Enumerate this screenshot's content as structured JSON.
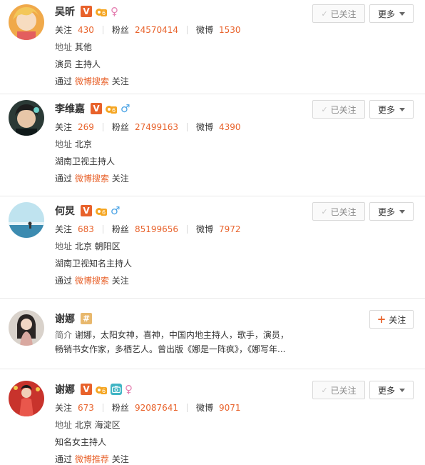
{
  "labels": {
    "followed": "已关注",
    "more": "更多",
    "follow": "关注",
    "following": "关注",
    "fans": "粉丝",
    "weibo": "微博",
    "address": "地址",
    "via": "通过",
    "follow_suffix": "关注",
    "intro": "简介"
  },
  "users": [
    {
      "name": "吴昕",
      "following": "430",
      "fans": "24570414",
      "weibo": "1530",
      "address": "其他",
      "desc": "演员 主持人",
      "source": "微博搜索"
    },
    {
      "name": "李维嘉",
      "following": "269",
      "fans": "27499163",
      "weibo": "4390",
      "address": "北京",
      "desc": "湖南卫视主持人",
      "source": "微博搜索"
    },
    {
      "name": "何炅",
      "following": "683",
      "fans": "85199656",
      "weibo": "7972",
      "address": "北京 朝阳区",
      "desc": "湖南卫视知名主持人",
      "source": "微博搜索"
    },
    {
      "name": "谢娜",
      "intro_text": "谢娜，太阳女神，喜神，中国内地主持人，歌手，演员，畅销书女作家，多栖艺人。曾出版《娜是一阵疯》，《娜写年..."
    },
    {
      "name": "谢娜",
      "following": "673",
      "fans": "92087641",
      "weibo": "9071",
      "address": "北京 海淀区",
      "desc": "知名女主持人",
      "source": "微博推荐"
    }
  ],
  "colors": {
    "accent": "#e8622b",
    "female": "#e582b2",
    "male": "#4aa3e5"
  }
}
